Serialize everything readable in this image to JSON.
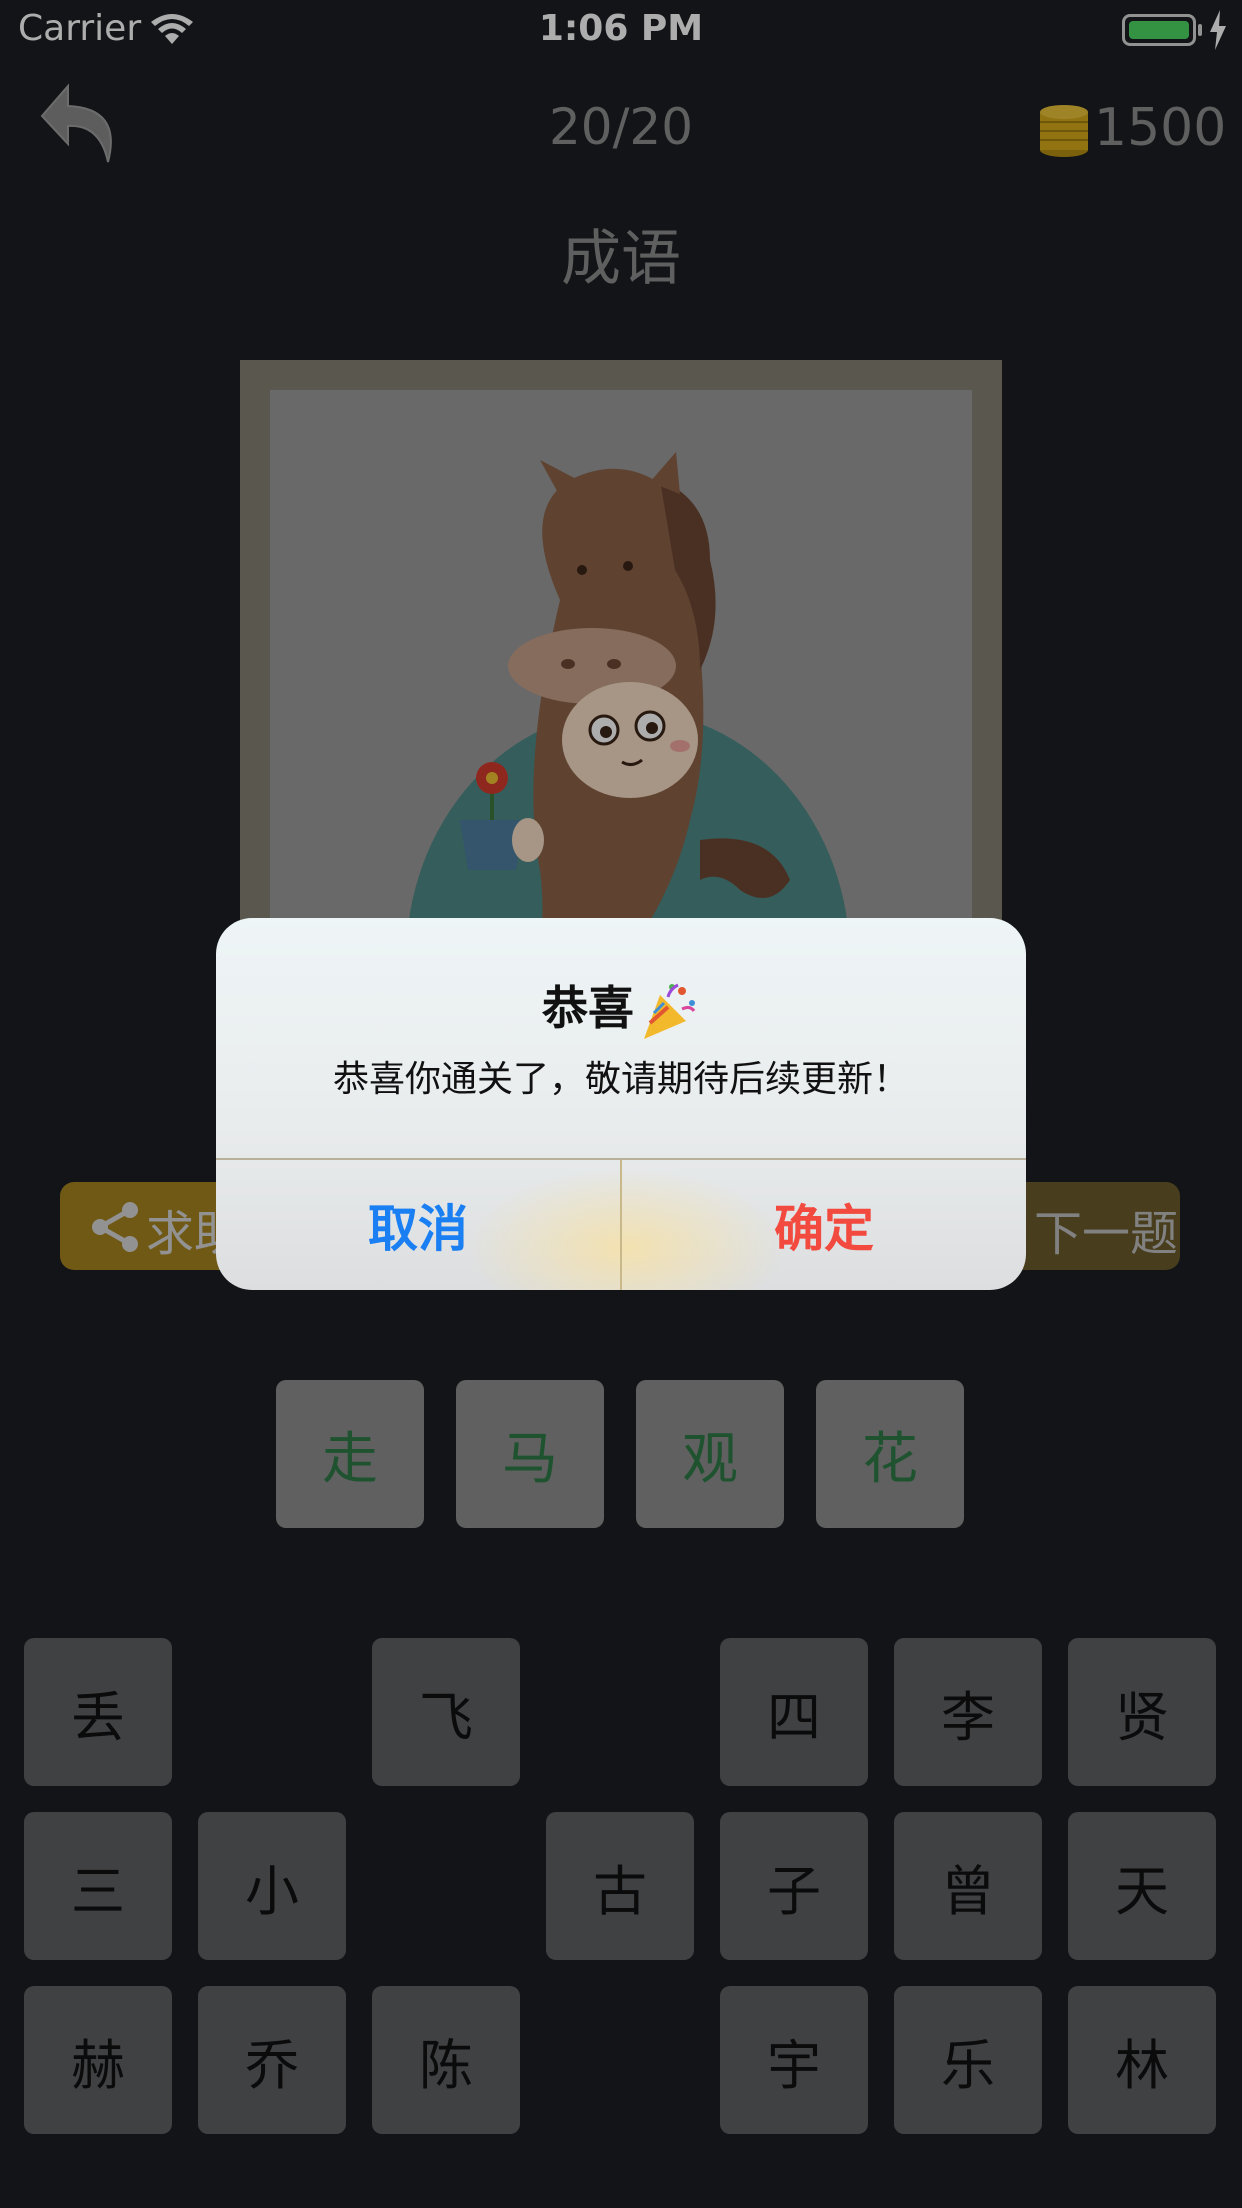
{
  "status_bar": {
    "carrier": "Carrier",
    "time": "1:06 PM"
  },
  "nav": {
    "level": "20/20",
    "coins": "1500"
  },
  "category": "成语",
  "actions": {
    "help_label": "求助",
    "next_label": "下一题"
  },
  "answer": [
    "走",
    "马",
    "观",
    "花"
  ],
  "keyboard": [
    [
      "丢",
      "",
      "飞",
      "",
      "四",
      "李",
      "贤"
    ],
    [
      "三",
      "小",
      "",
      "古",
      "子",
      "曾",
      "天"
    ],
    [
      "赫",
      "乔",
      "陈",
      "",
      "宇",
      "乐",
      "林"
    ]
  ],
  "alert": {
    "title": "恭喜",
    "message": "恭喜你通关了，敬请期待后续更新！",
    "cancel_label": "取消",
    "confirm_label": "确定"
  },
  "icons": {
    "back": "back-arrow-icon",
    "coins": "coin-stack-icon",
    "share": "share-icon",
    "party": "party-popper-icon"
  },
  "colors": {
    "background": "#1b1e22",
    "help_button": "#a4831f",
    "answer_text": "#2f7b48",
    "cancel": "#1a7ff3",
    "confirm": "#f24a3e"
  }
}
